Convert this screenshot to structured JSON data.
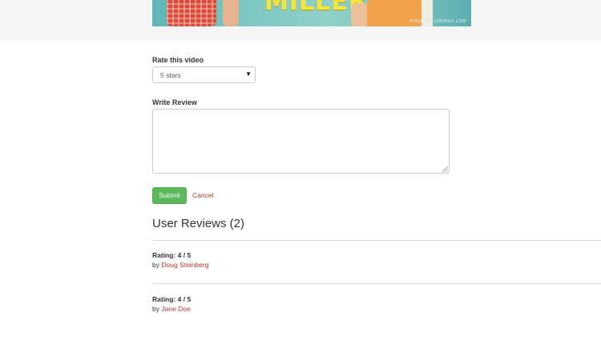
{
  "poster": {
    "title": "MILLERS",
    "watermark": "WWW.WALLPAPERS.COM"
  },
  "rating": {
    "label": "Rate this video",
    "selected": "5 stars"
  },
  "review_form": {
    "label": "Write Review",
    "value": "",
    "submit_label": "Submit",
    "cancel_label": "Cancel"
  },
  "user_reviews": {
    "heading": "User Reviews (2)",
    "items": [
      {
        "rating": "Rating: 4 / 5",
        "by": "by",
        "author": "Doug Steinberg"
      },
      {
        "rating": "Rating: 4 / 5",
        "by": "by",
        "author": "Jane Doe"
      }
    ]
  },
  "colors": {
    "submit": "#5cb85c",
    "link": "#c0392b",
    "poster_title": "#f6e43a"
  }
}
